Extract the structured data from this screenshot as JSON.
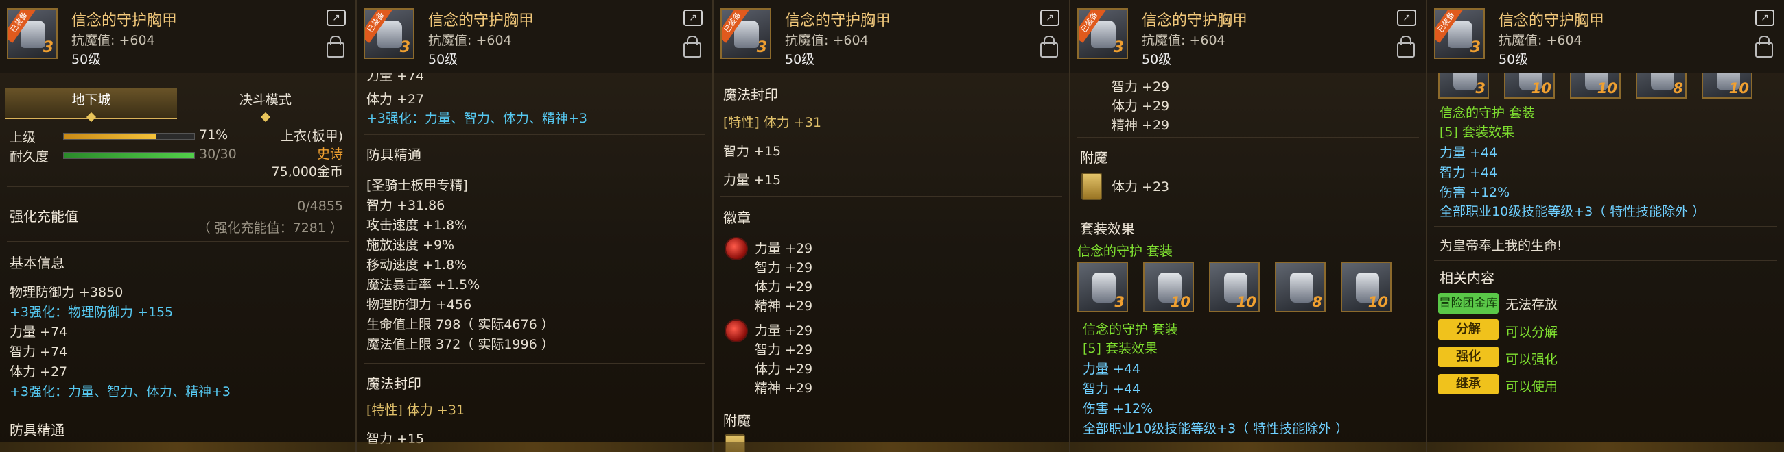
{
  "item": {
    "name": "信念的守护胸甲",
    "magic_resist": "抗魔值: +604",
    "level": "50级",
    "badge": "已装备",
    "icon_level": "3"
  },
  "tabs": [
    "地下城",
    "决斗模式"
  ],
  "grade": {
    "label": "上级",
    "percent": "71%",
    "percent_value": 71
  },
  "durability": {
    "label": "耐久度",
    "value": "30/30",
    "fraction": 1.0
  },
  "slot": "上衣(板甲)",
  "rarity": "史诗",
  "price": "75,000金币",
  "charge": {
    "label": "强化充能值",
    "value": "0/4855",
    "sub": "（ 强化充能值：7281 ）"
  },
  "basic": {
    "title": "基本信息",
    "lines": [
      "物理防御力 +3850",
      "+3强化：物理防御力 +155",
      "力量 +74",
      "智力 +74",
      "体力 +27",
      "+3强化：力量、智力、体力、精神+3"
    ]
  },
  "mastery": {
    "title": "防具精通",
    "lines": [
      "[圣骑士板甲专精]",
      "智力 +31.86",
      "攻击速度 +1.8%",
      "施放速度 +9%",
      "移动速度 +1.8%",
      "魔法暴击率 +1.5%",
      "物理防御力 +456",
      "生命值上限 798（ 实际4676 ）",
      "魔法值上限 372（ 实际1996 ）"
    ]
  },
  "p2_top": [
    "力量 +74",
    "体力 +27"
  ],
  "seal": {
    "title": "魔法封印",
    "lines": [
      "[特性] 体力 +31",
      "智力 +15",
      "力量 +15"
    ]
  },
  "emblem": {
    "title": "徽章",
    "groups": [
      [
        "力量 +29",
        "智力 +29",
        "体力 +29",
        "精神 +29"
      ],
      [
        "力量 +29",
        "智力 +29",
        "体力 +29",
        "精神 +29"
      ]
    ]
  },
  "enchant": {
    "title": "附魔",
    "line": "体力 +23"
  },
  "set": {
    "section_title": "套装效果",
    "name": "信念的守护  套装",
    "effect_title": "[5] 套装效果",
    "lines": [
      "力量 +44",
      "智力 +44",
      "伤害 +12%",
      "全部职业10级技能等级+3（ 特性技能除外 ）"
    ],
    "icons": [
      "3",
      "10",
      "10",
      "8",
      "10"
    ]
  },
  "p4_top": [
    "智力 +29",
    "体力 +29",
    "精神 +29"
  ],
  "flavor": "为皇帝奉上我的生命!",
  "related": {
    "title": "相关内容",
    "vault_label": "冒险团金库",
    "vault_text": "无法存放",
    "rows": [
      {
        "button": "分解",
        "text": "可以分解"
      },
      {
        "button": "强化",
        "text": "可以强化"
      },
      {
        "button": "继承",
        "text": "可以使用"
      }
    ]
  }
}
